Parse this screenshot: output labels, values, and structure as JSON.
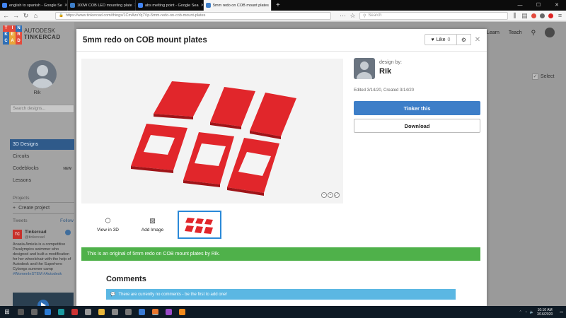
{
  "browser": {
    "tabs": [
      {
        "label": "english to spanish - Google Se",
        "color": "#4285f4",
        "active": false
      },
      {
        "label": "100W COB LED mounting plate",
        "color": "#3d7ec8",
        "active": false
      },
      {
        "label": "abs melting point - Google Sea",
        "color": "#4285f4",
        "active": false
      },
      {
        "label": "5mm redo on COB mount plates",
        "color": "#3d7ec8",
        "active": true
      }
    ],
    "url": "https://www.tinkercad.com/things/1CmAzsYq7Vp-5mm-redo-on-cob-mount-plates",
    "search_placeholder": "Search"
  },
  "site": {
    "logo_letters": [
      "T",
      "I",
      "N",
      "K",
      "E",
      "R",
      "C",
      "A",
      "D"
    ],
    "logo_colors": [
      "#e34a3c",
      "#e34a3c",
      "#2f6fb6",
      "#2f6fb6",
      "#e9a53a",
      "#e34a3c",
      "#2f6fb6",
      "#e9a53a",
      "#e34a3c"
    ],
    "brand_line1": "AUTODESK",
    "brand_line2": "TINKERCAD",
    "nav": {
      "learn": "Learn",
      "teach": "Teach"
    },
    "select_label": "Select"
  },
  "sidebar": {
    "username": "Rik",
    "search_placeholder": "Search designs...",
    "items": [
      {
        "label": "3D Designs",
        "badge": ""
      },
      {
        "label": "Circuits",
        "badge": ""
      },
      {
        "label": "Codeblocks",
        "badge": "NEW"
      },
      {
        "label": "Lessons",
        "badge": ""
      }
    ],
    "projects_header": "Projects",
    "create_project": "Create project",
    "tweets_header": "Tweets",
    "follow_label": "Follow",
    "tweet": {
      "author": "Tinkercad",
      "handle": "@tinkercad",
      "text": "Anasia Amiela is a competitive Paralympics swimmer who designed and built a modification for her wheelchair with the help of Autodesk and the Superhero Cyborgs summer camp",
      "tags": "#WomenInSTEM #Autodesk"
    }
  },
  "modal": {
    "title": "5mm redo on COB mount plates",
    "like_label": "Like",
    "like_count": "0",
    "designer_label": "design by:",
    "designer_name": "Rik",
    "dates": "Edited 3/14/20, Created 3/14/20",
    "tinker_button": "Tinker this",
    "download_button": "Download",
    "thumbnails": [
      {
        "label": "View in 3D",
        "icon": "cube-icon"
      },
      {
        "label": "Add Image",
        "icon": "image-icon"
      }
    ],
    "original_notice": "This is an original of 5mm redo on COB mount plates by Rik.",
    "comments_title": "Comments",
    "no_comments": "There are currently no comments - be the first to add one!"
  },
  "taskbar": {
    "time": "10:16 AM",
    "date": "3/16/2020"
  }
}
